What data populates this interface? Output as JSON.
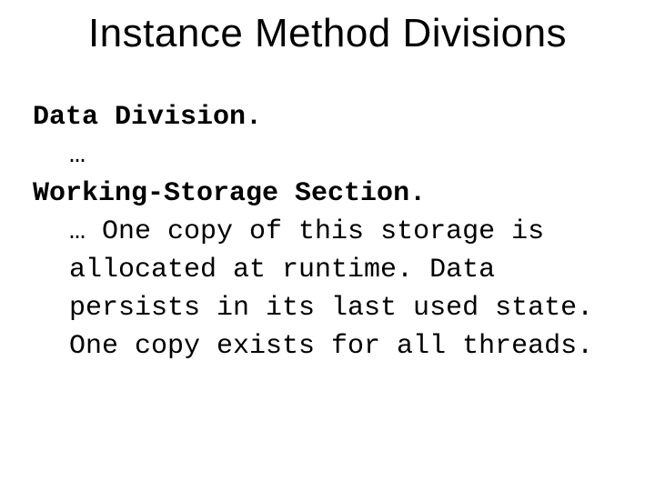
{
  "title": "Instance Method Divisions",
  "body": {
    "line1": "Data Division.",
    "line2": "…",
    "line3": "Working-Storage Section.",
    "para_lead": "… ",
    "para_rest": "One copy of this storage is allocated at runtime.  Data persists in its last used state. One copy exists for all threads."
  }
}
